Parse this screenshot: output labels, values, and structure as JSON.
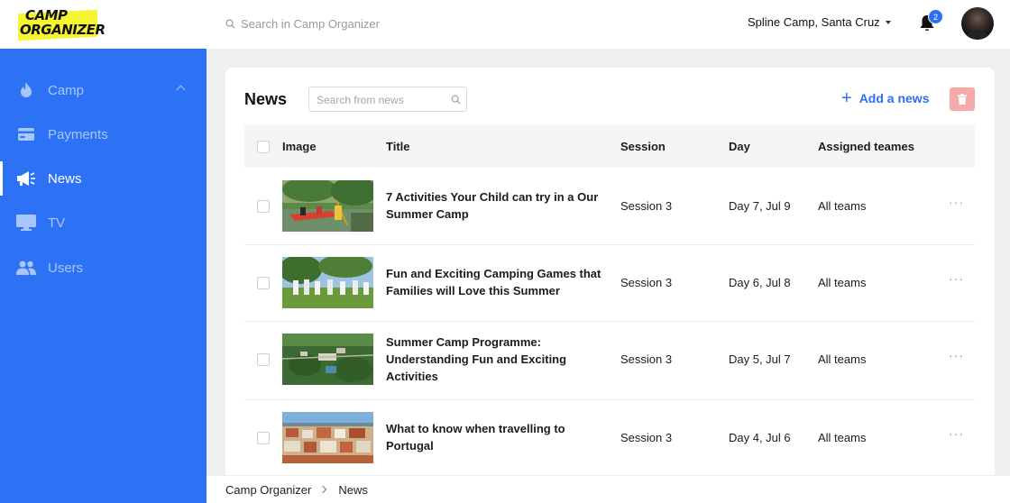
{
  "brand": {
    "line1": "CAMP",
    "line2": "ORGANIZER"
  },
  "topbar": {
    "search_placeholder": "Search in Camp Organizer",
    "camp_name": "Spline Camp, Santa Cruz",
    "notification_count": "2"
  },
  "sidebar": {
    "items": [
      {
        "label": "Camp",
        "icon": "flame-icon",
        "active": false
      },
      {
        "label": "Payments",
        "icon": "credit-card-icon",
        "active": false
      },
      {
        "label": "News",
        "icon": "megaphone-icon",
        "active": true
      },
      {
        "label": "TV",
        "icon": "monitor-icon",
        "active": false
      },
      {
        "label": "Users",
        "icon": "users-icon",
        "active": false
      }
    ]
  },
  "news": {
    "title": "News",
    "search_placeholder": "Search from news",
    "add_label": "Add a news",
    "columns": {
      "image": "Image",
      "title": "Title",
      "session": "Session",
      "day": "Day",
      "teams": "Assigned teames"
    },
    "rows": [
      {
        "title": "7 Activities Your Child can try in a Our Summer Camp",
        "session": "Session 3",
        "day": "Day 7, Jul 9",
        "teams": "All teams",
        "more": "···"
      },
      {
        "title": "Fun and Exciting Camping Games that Families will Love this Summer",
        "session": "Session 3",
        "day": "Day 6, Jul 8",
        "teams": "All teams",
        "more": "···"
      },
      {
        "title": "Summer Camp Programme: Understanding Fun and Exciting Activities",
        "session": "Session 3",
        "day": "Day 5, Jul 7",
        "teams": "All teams",
        "more": "···"
      },
      {
        "title": "What to know when travelling to Portugal",
        "session": "Session 3",
        "day": "Day 4, Jul 6",
        "teams": "All teams",
        "more": "···"
      }
    ]
  },
  "breadcrumb": {
    "root": "Camp Organizer",
    "current": "News"
  },
  "colors": {
    "accent": "#2d72f5",
    "delete_bg": "#f7a9a9",
    "brand_yellow": "#f5f531"
  }
}
